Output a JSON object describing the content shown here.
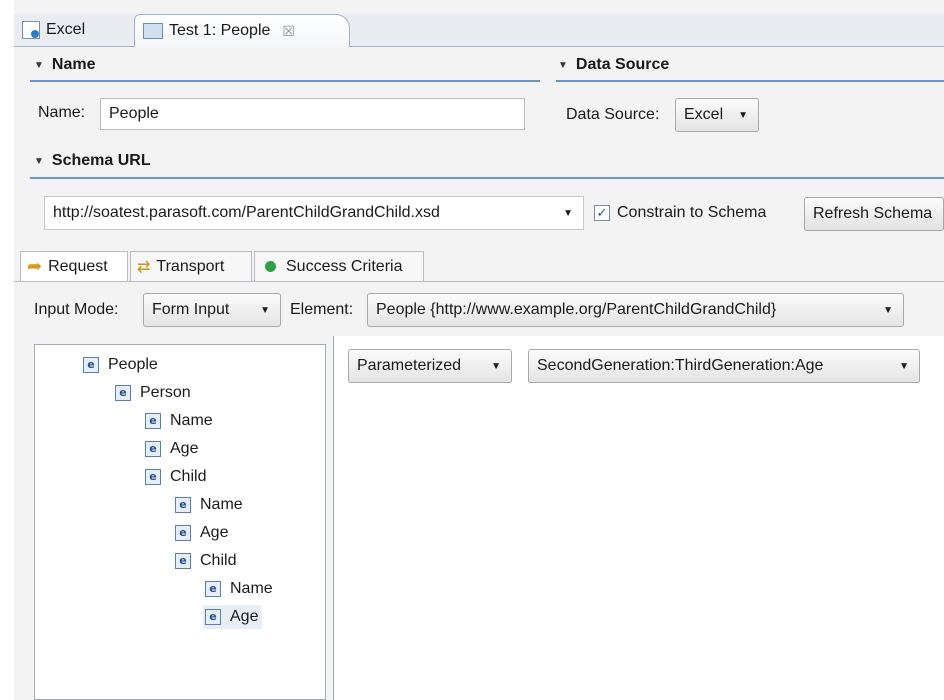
{
  "editor_tabs": [
    {
      "label": "Excel",
      "icon": "excel-icon"
    },
    {
      "label": "Test 1: People",
      "icon": "test-icon",
      "close": "☒"
    }
  ],
  "name_section": {
    "header": "Name",
    "label": "Name:",
    "value": "People"
  },
  "data_source_section": {
    "header": "Data Source",
    "label": "Data Source:",
    "value": "Excel"
  },
  "schema_section": {
    "header": "Schema URL",
    "url": "http://soatest.parasoft.com/ParentChildGrandChild.xsd",
    "constrain_label": "Constrain to Schema",
    "constrain_checked": true,
    "refresh_label": "Refresh Schema"
  },
  "inner_tabs": [
    {
      "label": "Request",
      "icon": "request-icon"
    },
    {
      "label": "Transport",
      "icon": "transport-icon"
    },
    {
      "label": "Success Criteria",
      "icon": "success-icon"
    }
  ],
  "input_mode": {
    "label": "Input Mode:",
    "value": "Form Input"
  },
  "element": {
    "label": "Element:",
    "value": "People {http://www.example.org/ParentChildGrandChild}"
  },
  "tree": [
    {
      "label": "People"
    },
    {
      "label": "Person"
    },
    {
      "label": "Name"
    },
    {
      "label": "Age"
    },
    {
      "label": "Child"
    },
    {
      "label": "Name"
    },
    {
      "label": "Age"
    },
    {
      "label": "Child"
    },
    {
      "label": "Name"
    },
    {
      "label": "Age",
      "selected": true
    }
  ],
  "element_icon_glyph": "e",
  "value_mode": {
    "value": "Parameterized"
  },
  "parameter": {
    "value": "SecondGeneration:ThirdGeneration:Age"
  },
  "colors": {
    "section_line": "#6f94bf",
    "success_dot": "#2ea043"
  }
}
